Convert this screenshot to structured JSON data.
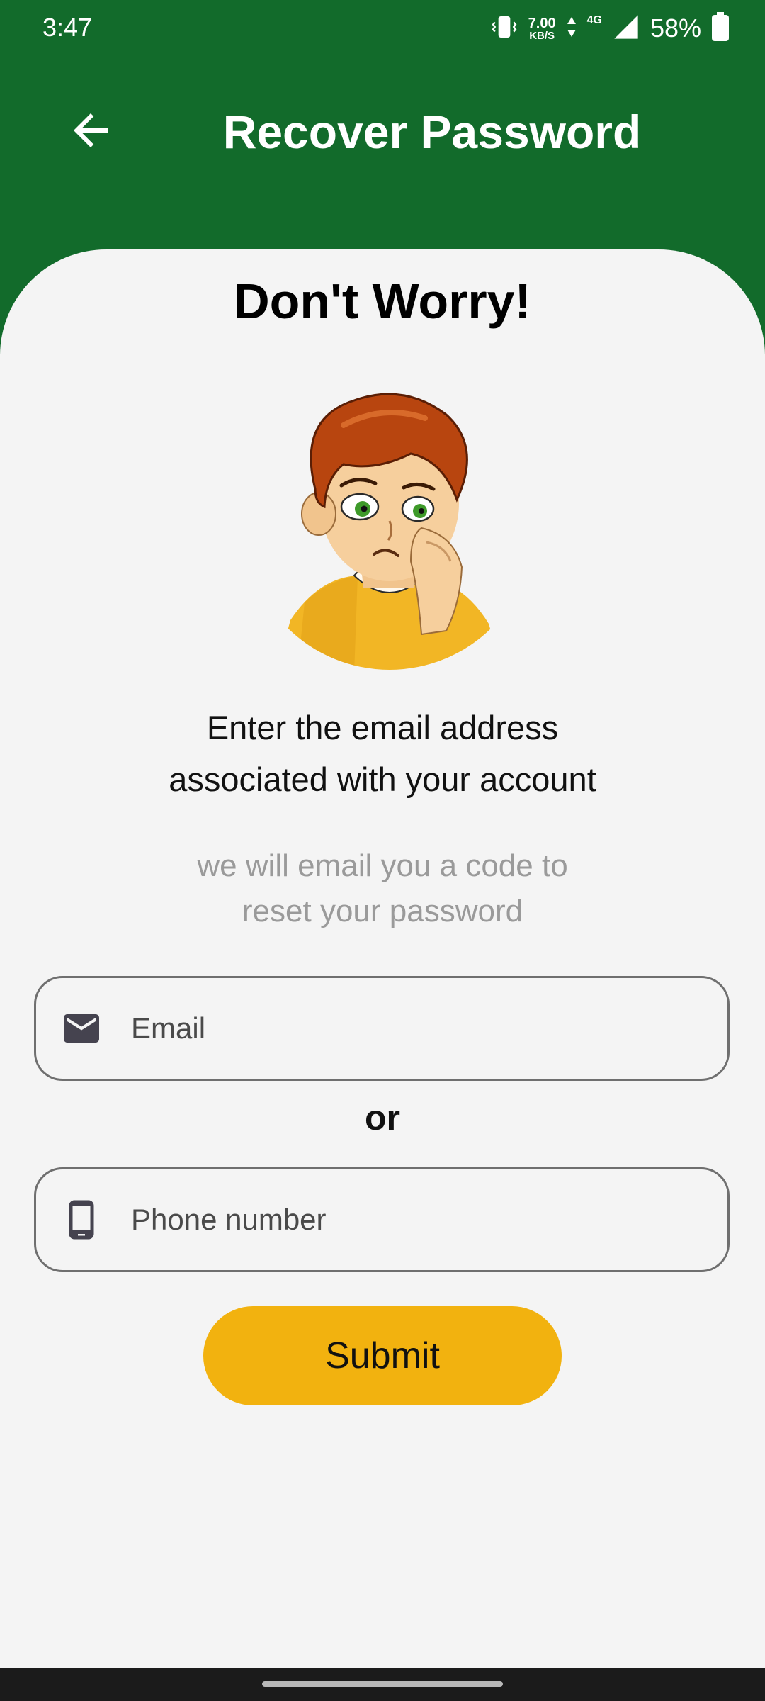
{
  "status_bar": {
    "time": "3:47",
    "speed_value": "7.00",
    "speed_unit": "KB/S",
    "network": "4G",
    "battery": "58%",
    "icons": [
      "vibrate-icon",
      "data-arrows-icon",
      "signal-icon",
      "battery-icon"
    ]
  },
  "app_bar": {
    "title": "Recover Password",
    "back_icon": "arrow-back-icon",
    "background_color": "#126b2b"
  },
  "content": {
    "headline": "Don't Worry!",
    "illustration": "sad-boy-illustration",
    "main_text_line1": "Enter the email address",
    "main_text_line2": "associated with your account",
    "sub_text_line1": "we will email you a code to",
    "sub_text_line2": "reset your password",
    "email_field": {
      "placeholder": "Email",
      "value": "",
      "icon": "mail-icon"
    },
    "or_text": "or",
    "phone_field": {
      "placeholder": "Phone number",
      "value": "",
      "icon": "phone-icon"
    },
    "submit_label": "Submit",
    "submit_color": "#f2b20f"
  }
}
